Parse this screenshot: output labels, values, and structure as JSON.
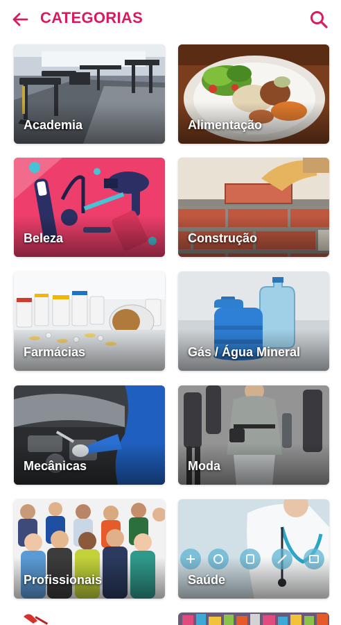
{
  "header": {
    "title": "CATEGORIAS",
    "back_icon": "arrow-left-icon",
    "search_icon": "search-icon",
    "accent_color": "#d81b60"
  },
  "categories": [
    {
      "label": "Academia"
    },
    {
      "label": "Alimentação"
    },
    {
      "label": "Beleza"
    },
    {
      "label": "Construção"
    },
    {
      "label": "Farmácias"
    },
    {
      "label": "Gás / Água Mineral"
    },
    {
      "label": "Mecânicas"
    },
    {
      "label": "Moda"
    },
    {
      "label": "Profissionais"
    },
    {
      "label": "Saúde"
    }
  ]
}
